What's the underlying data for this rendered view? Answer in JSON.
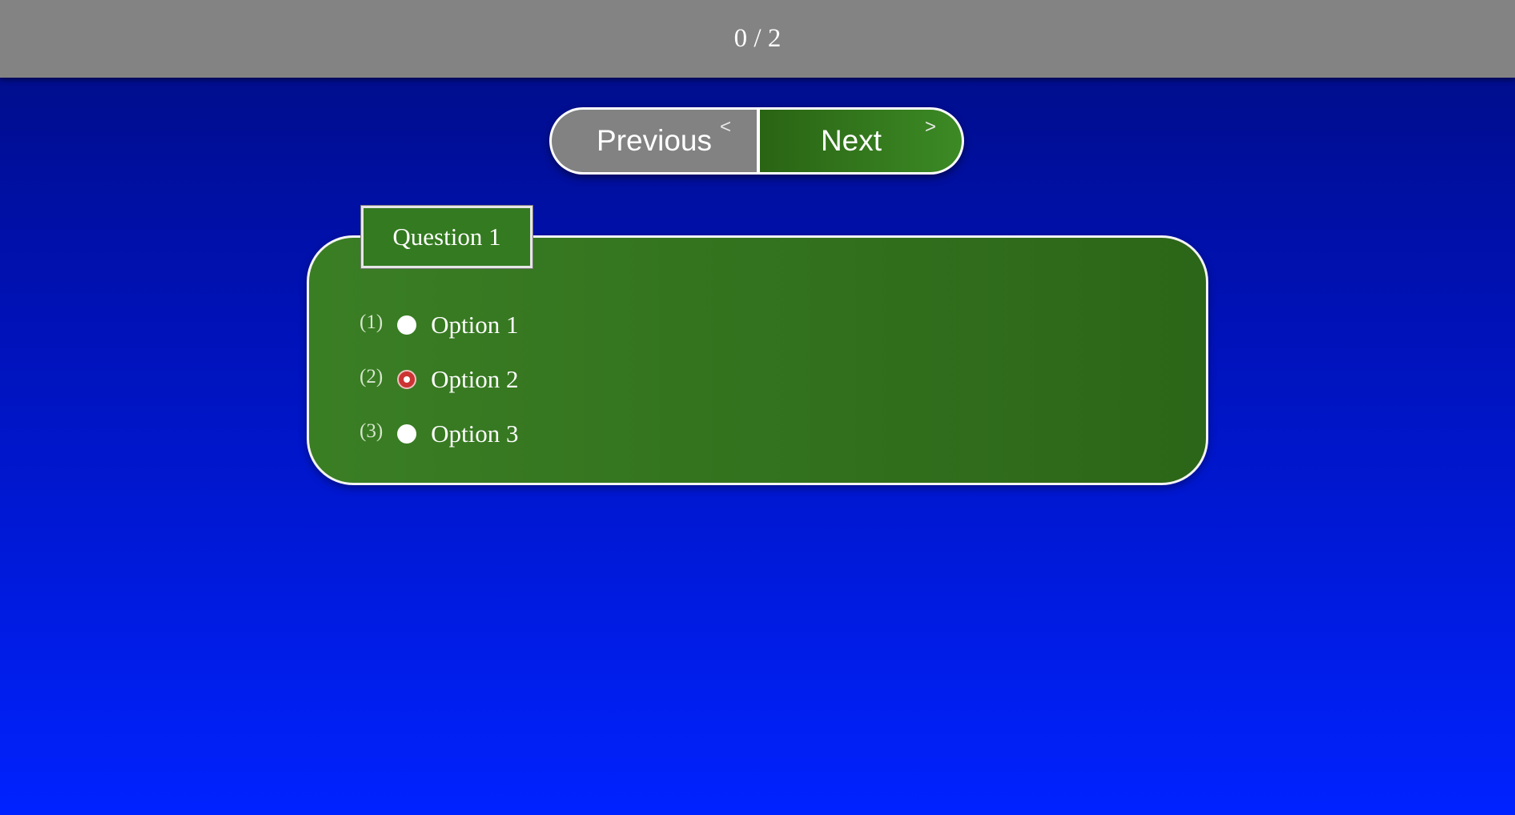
{
  "header": {
    "progress": "0 / 2"
  },
  "nav": {
    "previous_label": "Previous",
    "previous_chevron": "<",
    "next_label": "Next",
    "next_chevron": ">"
  },
  "question": {
    "title": "Question 1",
    "options": [
      {
        "number": "(1)",
        "label": "Option 1",
        "selected": false
      },
      {
        "number": "(2)",
        "label": "Option 2",
        "selected": true
      },
      {
        "number": "(3)",
        "label": "Option 3",
        "selected": false
      }
    ]
  },
  "colors": {
    "top_bar": "#838383",
    "background_top": "#000c80",
    "background_bottom": "#0022ff",
    "panel_green": "#347a20",
    "selected_radio": "#cc3333"
  }
}
